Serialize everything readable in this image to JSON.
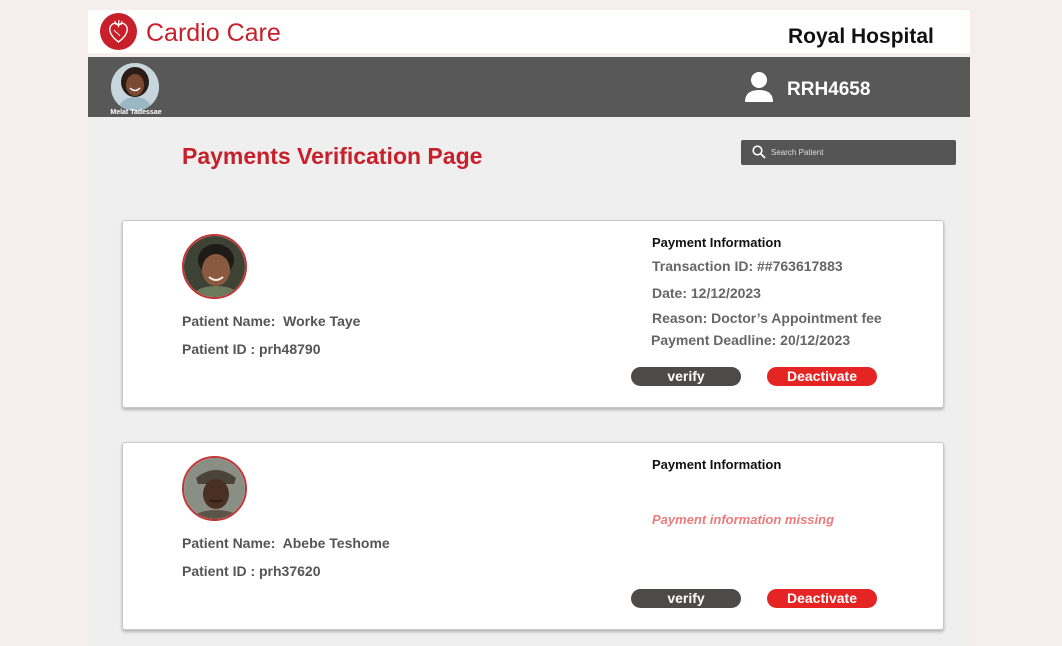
{
  "header": {
    "brand": "Cardio Care",
    "hospital": "Royal Hospital",
    "logo_icon": "heart-icon"
  },
  "userbar": {
    "avatar_name": "Melat Tadessae",
    "user_icon": "user-icon",
    "user_code": "RRH4658"
  },
  "page": {
    "title": "Payments Verification Page"
  },
  "search": {
    "placeholder": "Search Patient",
    "value": ""
  },
  "patients": [
    {
      "name_line": "Patient Name:  Worke Taye",
      "id_line": "Patient ID : prh48790",
      "payment_title": "Payment Information",
      "transaction": "Transaction ID: ##763617883",
      "date": "Date: 12/12/2023",
      "reason": "Reason: Doctor’s Appointment fee",
      "deadline": "Payment Deadline: 20/12/2023",
      "verify_label": "verify",
      "deactivate_label": "Deactivate"
    },
    {
      "name_line": "Patient Name:  Abebe Teshome",
      "id_line": "Patient ID : prh37620",
      "payment_title": "Payment Information",
      "missing": "Payment information missing",
      "verify_label": "verify",
      "deactivate_label": "Deactivate"
    }
  ],
  "colors": {
    "brand_red": "#c8202a",
    "bar_gray": "#585858",
    "verify_gray": "#4e4a4a",
    "deactivate_red": "#e52424",
    "missing_pink": "#ec7c7c"
  }
}
